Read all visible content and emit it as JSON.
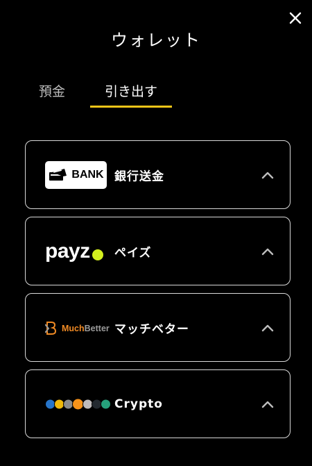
{
  "header": {
    "title": "ウォレット",
    "close_icon": "close-icon"
  },
  "tabs": [
    {
      "label": "預金",
      "active": false
    },
    {
      "label": "引き出す",
      "active": true
    }
  ],
  "accent_color": "#f5c518",
  "methods": [
    {
      "id": "bank",
      "logo_text": "BANK",
      "label": "銀行送金",
      "icon": "bank-card-icon"
    },
    {
      "id": "payz",
      "logo_text": "payz",
      "label": "ペイズ",
      "icon": "payz-logo"
    },
    {
      "id": "muchbetter",
      "logo_text_1": "Much",
      "logo_text_2": "Better",
      "label": "マッチベター",
      "icon": "muchbetter-logo"
    },
    {
      "id": "crypto",
      "label": "Crypto",
      "icon": "crypto-coins-icon"
    }
  ]
}
